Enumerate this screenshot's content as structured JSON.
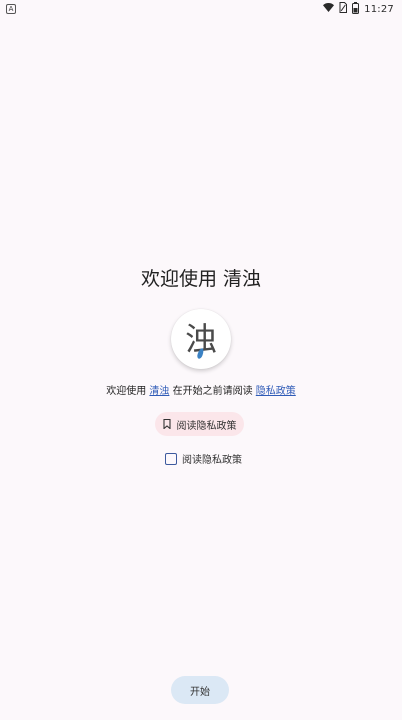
{
  "status_bar": {
    "notification_icon_letter": "A",
    "time": "11:27",
    "icons": [
      "notification-icon",
      "wifi-icon",
      "sim-icon",
      "battery-icon"
    ]
  },
  "welcome": {
    "title": "欢迎使用 清浊"
  },
  "logo": {
    "glyph": "浊",
    "accent_color": "#3b82c4"
  },
  "intro": {
    "prefix": "欢迎使用",
    "app_link": "清浊",
    "middle": "在开始之前请阅读",
    "policy_link": "隐私政策"
  },
  "read_policy_button": {
    "label": "阅读隐私政策",
    "icon": "bookmark-icon"
  },
  "checkbox": {
    "label": "阅读隐私政策",
    "checked": false
  },
  "start_button": {
    "label": "开始"
  },
  "colors": {
    "background": "#fcf8fb",
    "link": "#2f5bb7",
    "pill_pink": "#fbe6ea",
    "pill_blue": "#dbe8f5",
    "checkbox_border": "#3d5a9e"
  }
}
